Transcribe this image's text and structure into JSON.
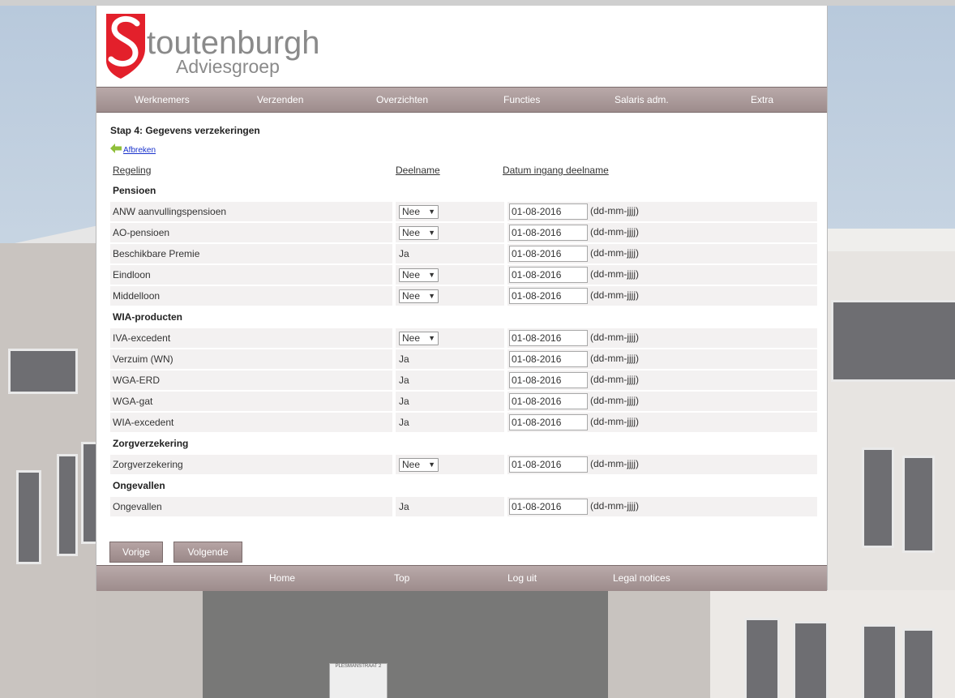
{
  "brand": {
    "logo_letter": "S",
    "name": "toutenburgh",
    "subtitle": "Adviesgroep",
    "accent_red": "#e3202b",
    "gray": "#8a8a8a"
  },
  "nav": {
    "items": [
      "Werknemers",
      "Verzenden",
      "Overzichten",
      "Functies",
      "Salaris adm.",
      "Extra"
    ]
  },
  "page": {
    "title": "Stap 4: Gegevens verzekeringen",
    "back_label": "Afbreken"
  },
  "table": {
    "headers": {
      "regeling": "Regeling",
      "deelname": "Deelname",
      "datum": "Datum ingang deelname"
    },
    "date_hint": "(dd-mm-jjjj)",
    "sections": [
      {
        "title": "Pensioen",
        "rows": [
          {
            "name": "ANW aanvullingspensioen",
            "deelname": "Nee",
            "type": "select",
            "date": "01-08-2016"
          },
          {
            "name": "AO-pensioen",
            "deelname": "Nee",
            "type": "select",
            "date": "01-08-2016"
          },
          {
            "name": "Beschikbare Premie",
            "deelname": "Ja",
            "type": "text",
            "date": "01-08-2016"
          },
          {
            "name": "Eindloon",
            "deelname": "Nee",
            "type": "select",
            "date": "01-08-2016"
          },
          {
            "name": "Middelloon",
            "deelname": "Nee",
            "type": "select",
            "date": "01-08-2016"
          }
        ]
      },
      {
        "title": "WIA-producten",
        "rows": [
          {
            "name": "IVA-excedent",
            "deelname": "Nee",
            "type": "select",
            "date": "01-08-2016"
          },
          {
            "name": "Verzuim (WN)",
            "deelname": "Ja",
            "type": "text",
            "date": "01-08-2016"
          },
          {
            "name": "WGA-ERD",
            "deelname": "Ja",
            "type": "text",
            "date": "01-08-2016"
          },
          {
            "name": "WGA-gat",
            "deelname": "Ja",
            "type": "text",
            "date": "01-08-2016"
          },
          {
            "name": "WIA-excedent",
            "deelname": "Ja",
            "type": "text",
            "date": "01-08-2016"
          }
        ]
      },
      {
        "title": "Zorgverzekering",
        "rows": [
          {
            "name": "Zorgverzekering",
            "deelname": "Nee",
            "type": "select",
            "date": "01-08-2016"
          }
        ]
      },
      {
        "title": "Ongevallen",
        "rows": [
          {
            "name": "Ongevallen",
            "deelname": "Ja",
            "type": "text",
            "date": "01-08-2016"
          }
        ]
      }
    ]
  },
  "buttons": {
    "prev": "Vorige",
    "next": "Volgende"
  },
  "footer": {
    "items": [
      "Home",
      "Top",
      "Log uit",
      "Legal notices"
    ]
  },
  "background": {
    "sign_text": "PLESMANSTRAAT 2"
  }
}
